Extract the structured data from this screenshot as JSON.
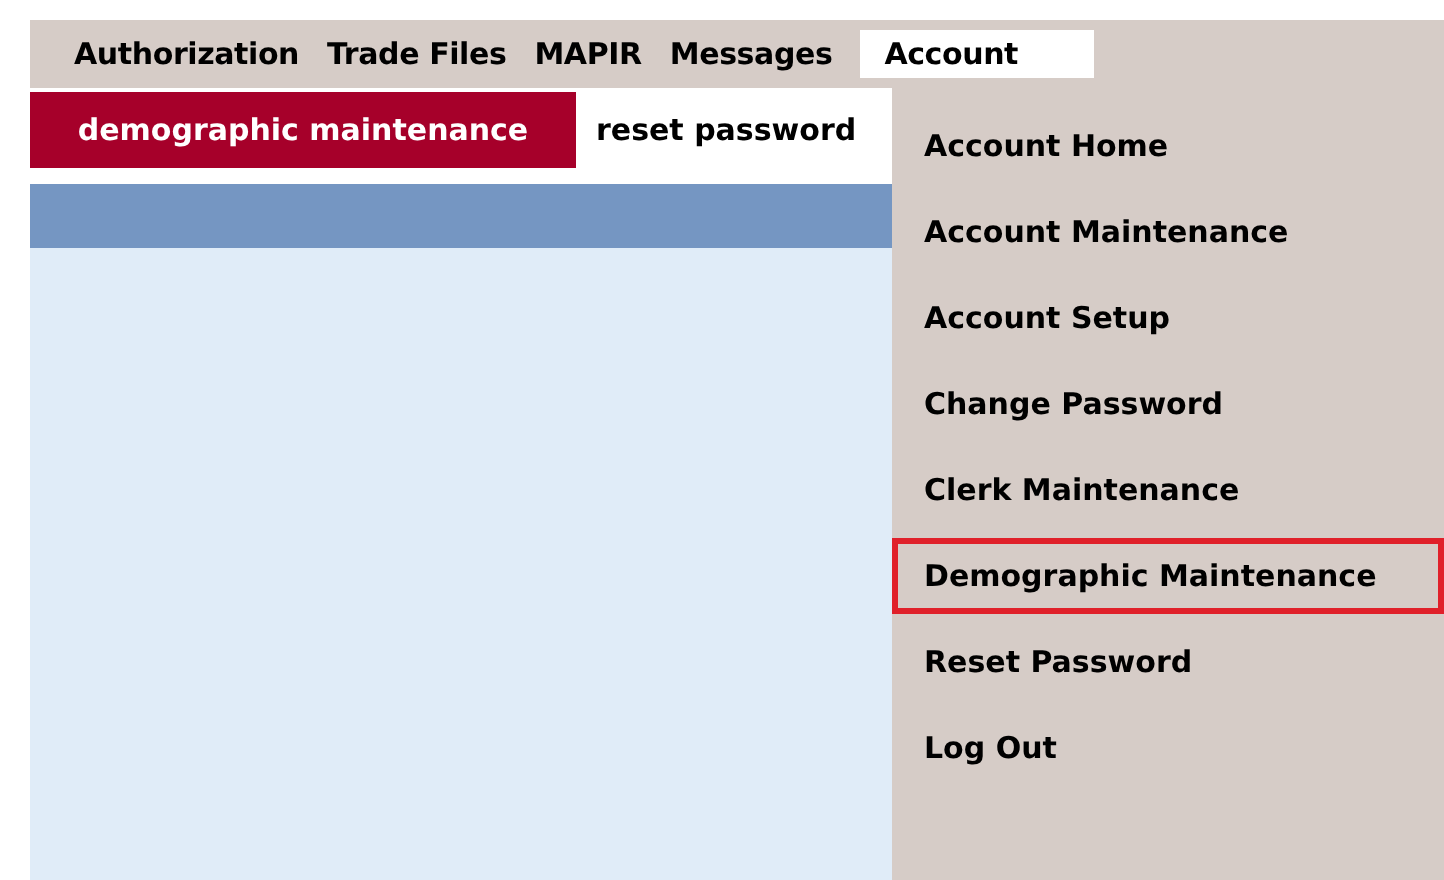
{
  "menu_bar": [
    {
      "label": "Authorization",
      "selected": false
    },
    {
      "label": "Trade Files",
      "selected": false
    },
    {
      "label": "MAPIR",
      "selected": false
    },
    {
      "label": "Messages",
      "selected": false
    },
    {
      "label": "Account",
      "selected": true
    }
  ],
  "tabs": [
    {
      "label": "demographic maintenance",
      "selected": true
    },
    {
      "label": "reset password",
      "selected": false
    }
  ],
  "dropdown": [
    {
      "label": "Account Home",
      "selected": false
    },
    {
      "label": "Account Maintenance",
      "selected": false
    },
    {
      "label": "Account Setup",
      "selected": false
    },
    {
      "label": "Change Password",
      "selected": false
    },
    {
      "label": "Clerk Maintenance",
      "selected": false
    },
    {
      "label": "Demographic Maintenance",
      "selected": true
    },
    {
      "label": "Reset Password",
      "selected": false
    },
    {
      "label": "Log Out",
      "selected": false
    }
  ]
}
